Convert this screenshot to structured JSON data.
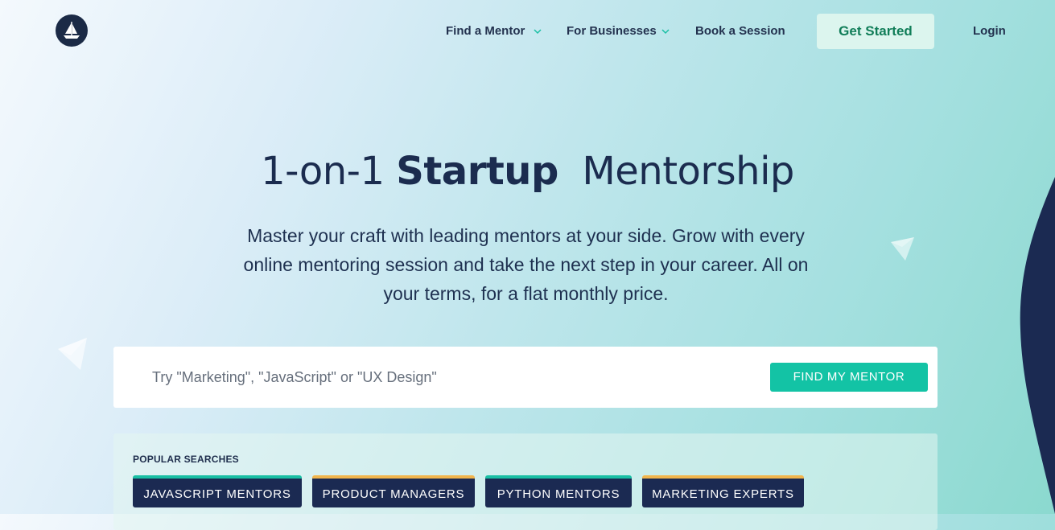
{
  "nav": {
    "items": [
      {
        "label": "Find a Mentor",
        "has_dropdown": true
      },
      {
        "label": "For Businesses",
        "has_dropdown": true
      },
      {
        "label": "Book a Session",
        "has_dropdown": false
      }
    ],
    "cta_label": "Get Started",
    "login_label": "Login"
  },
  "hero": {
    "title_part1": "1-on-1",
    "title_bold": "Startup",
    "title_part2": "Mentorship",
    "subtitle": "Master your craft with leading mentors at your side. Grow with every online mentoring session and take the next step in your career. All on your terms, for a flat monthly price."
  },
  "search": {
    "placeholder": "Try \"Marketing\", \"JavaScript\" or \"UX Design\"",
    "button_label": "FIND MY MENTOR"
  },
  "popular": {
    "title": "POPULAR SEARCHES",
    "tags": [
      {
        "label": "JAVASCRIPT MENTORS",
        "accent": "#19bfa4"
      },
      {
        "label": "PRODUCT MANAGERS",
        "accent": "#f1b54d"
      },
      {
        "label": "PYTHON MENTORS",
        "accent": "#19bfa4"
      },
      {
        "label": "MARKETING EXPERTS",
        "accent": "#f1b54d"
      }
    ]
  },
  "colors": {
    "navy": "#1b2a52",
    "teal": "#13c3a5",
    "cta_bg": "#dcf5ee",
    "cta_text": "#107d58"
  },
  "icons": [
    "sailboat-logo-icon",
    "chevron-down-icon"
  ]
}
